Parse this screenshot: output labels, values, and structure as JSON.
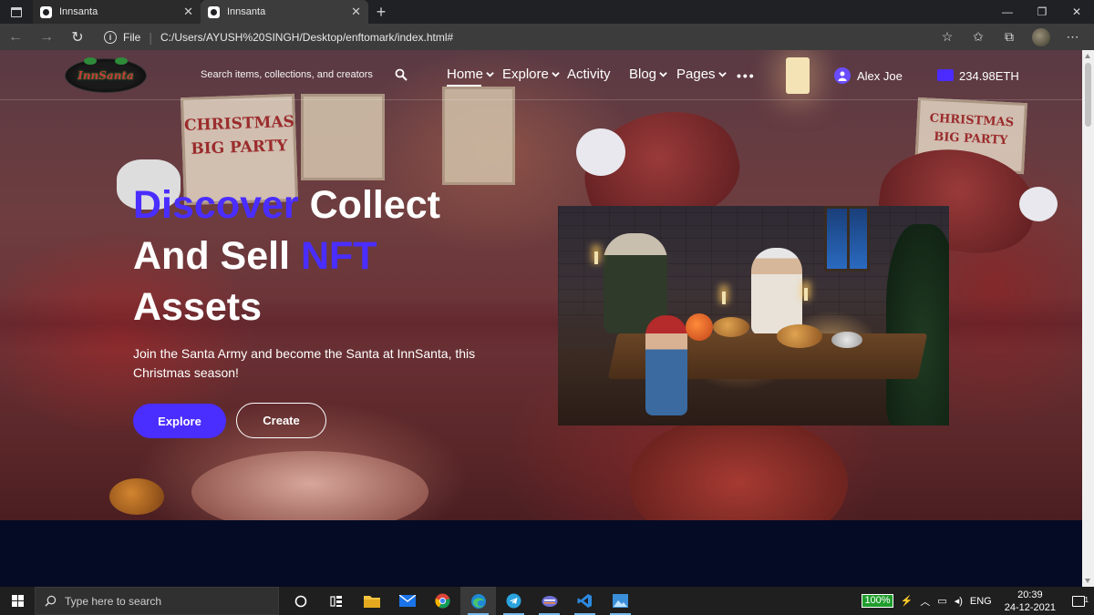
{
  "browser": {
    "tabs": [
      {
        "title": "Innsanta",
        "active": false
      },
      {
        "title": "Innsanta",
        "active": true
      }
    ],
    "protocol": "File",
    "url": "C:/Users/AYUSH%20SINGH/Desktop/enftomark/index.html#"
  },
  "header": {
    "logo_text": "InnSanta",
    "search_placeholder": "Search items, collections, and creators",
    "nav": [
      {
        "label": "Home",
        "has_dropdown": true,
        "active": true
      },
      {
        "label": "Explore",
        "has_dropdown": true
      },
      {
        "label": "Activity",
        "has_dropdown": false
      },
      {
        "label": "Blog",
        "has_dropdown": true
      },
      {
        "label": "Pages",
        "has_dropdown": true
      }
    ],
    "more": "•••",
    "user_name": "Alex Joe",
    "wallet_amount": "234.98ETH"
  },
  "hero": {
    "headline_accent_1": "Discover",
    "headline_plain_1": " Collect",
    "headline_plain_2": "And Sell ",
    "headline_accent_2": "NFT",
    "headline_plain_3": "Assets",
    "subtitle": "Join the Santa Army and become the Santa at InnSanta, this Christmas season!",
    "explore_label": "Explore",
    "create_label": "Create",
    "background_posters": [
      "CHRISTMAS",
      "BIG PARTY"
    ]
  },
  "taskbar": {
    "search_placeholder": "Type here to search",
    "battery": "100%",
    "language": "ENG",
    "time": "20:39",
    "date": "24-12-2021",
    "notifications": "1"
  },
  "colors": {
    "accent": "#4a2dff",
    "dark_section": "#050b24",
    "browser_tabbar": "#202124",
    "browser_addrbar": "#3c3c3c",
    "taskbar": "#1f1f1f"
  }
}
